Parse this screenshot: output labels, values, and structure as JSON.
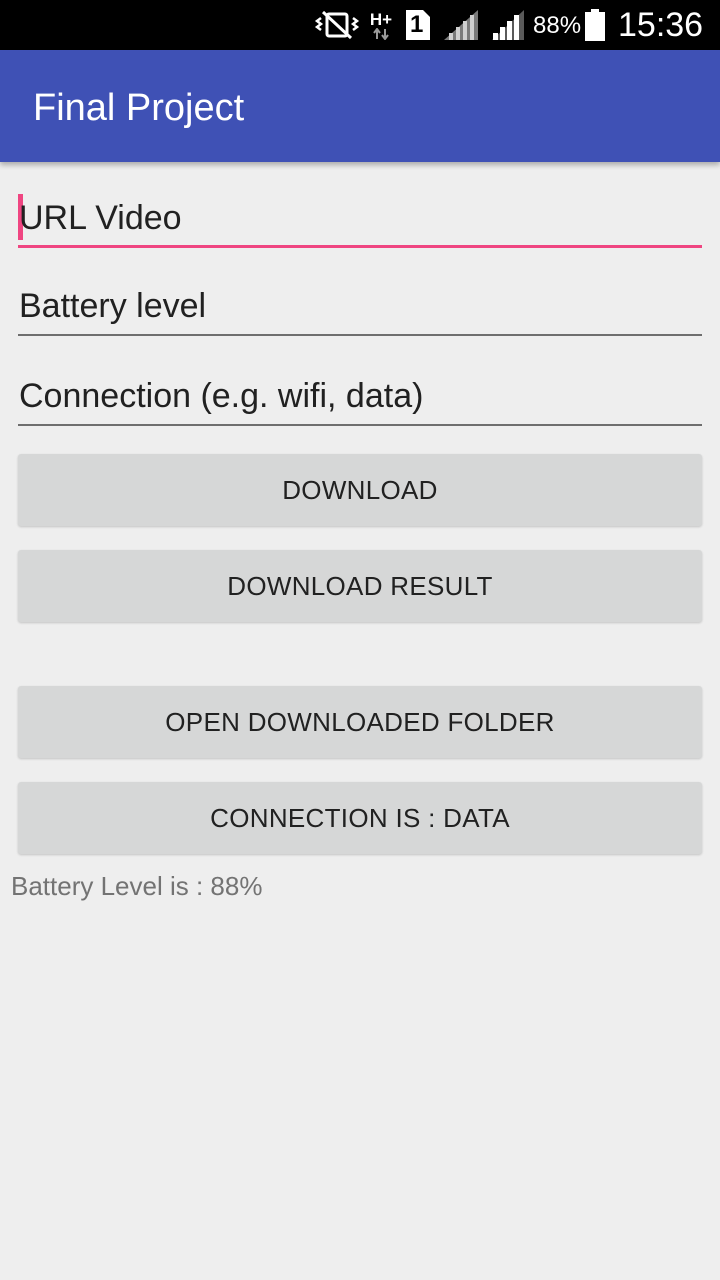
{
  "status_bar": {
    "icons": [
      "vibrate-mute-icon",
      "hspa-plus-icon",
      "sim-1-icon",
      "signal-icon-sim1",
      "signal-icon-sim2",
      "battery-icon"
    ],
    "network_type": "H+",
    "sim_slot": "1",
    "battery_percent": "88%",
    "battery_level": 0.88,
    "time": "15:36"
  },
  "app_bar": {
    "title": "Final Project",
    "color": "#3f51b5"
  },
  "form": {
    "url_field": {
      "hint": "URL Video",
      "value": "",
      "focused": true
    },
    "battery_field": {
      "hint": "Battery level",
      "value": ""
    },
    "connection_field": {
      "hint": "Connection (e.g. wifi, data)",
      "value": ""
    }
  },
  "buttons": {
    "download": "DOWNLOAD",
    "download_result": "DOWNLOAD RESULT",
    "open_folder": "OPEN DOWNLOADED FOLDER",
    "connection": "CONNECTION IS : DATA"
  },
  "info": {
    "battery_text": "Battery Level is : 88%"
  },
  "colors": {
    "accent": "#ef4581",
    "primary": "#3f51b5",
    "button_bg": "#d6d7d7",
    "background": "#eeeeee"
  }
}
